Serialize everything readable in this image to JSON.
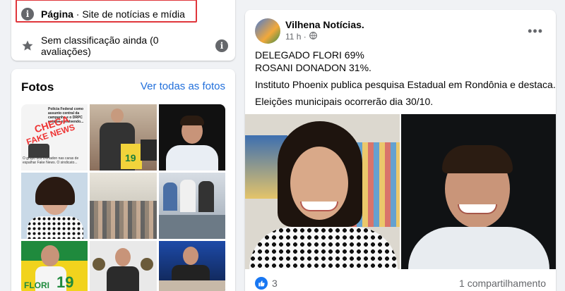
{
  "intro": {
    "page_label": "Página",
    "page_category": " · Site de notícias e mídia",
    "rating_text": "Sem classificação ainda (0 avaliações)"
  },
  "photos": {
    "title": "Fotos",
    "see_all": "Ver todas as fotos",
    "thumb1_text": "Polícia Federal como assunto central da campanha e o DRPC está se envolvendo...",
    "thumb1_stamp1": "CHEGA",
    "thumb1_stamp2": "FAKE NEWS",
    "thumb1_caption": "O grupo dos Donadon nas caras de espalhar Fake News. O sindicato...",
    "thumb2_number": "19",
    "thumb7_name": "FLORI",
    "thumb7_number": "19"
  },
  "post": {
    "author": "Vilhena Notícias.",
    "time": "11 h ·",
    "line1": "DELEGADO FLORI 69%",
    "line2": "ROSANI DONADON 31%.",
    "line3": "Instituto Phoenix publica pesquisa Estadual em Rondônia e destaca.",
    "line4": "Eleições municipais ocorrerão dia 30/10.",
    "likes": "3",
    "shares": "1 compartilhamento"
  },
  "colors": {
    "link": "#216fdb",
    "highlight": "#e0363b",
    "like": "#1877f2"
  },
  "icons": {
    "info": "info-icon",
    "star": "star-icon",
    "globe": "globe-icon",
    "more": "more-icon",
    "like": "like-icon"
  }
}
